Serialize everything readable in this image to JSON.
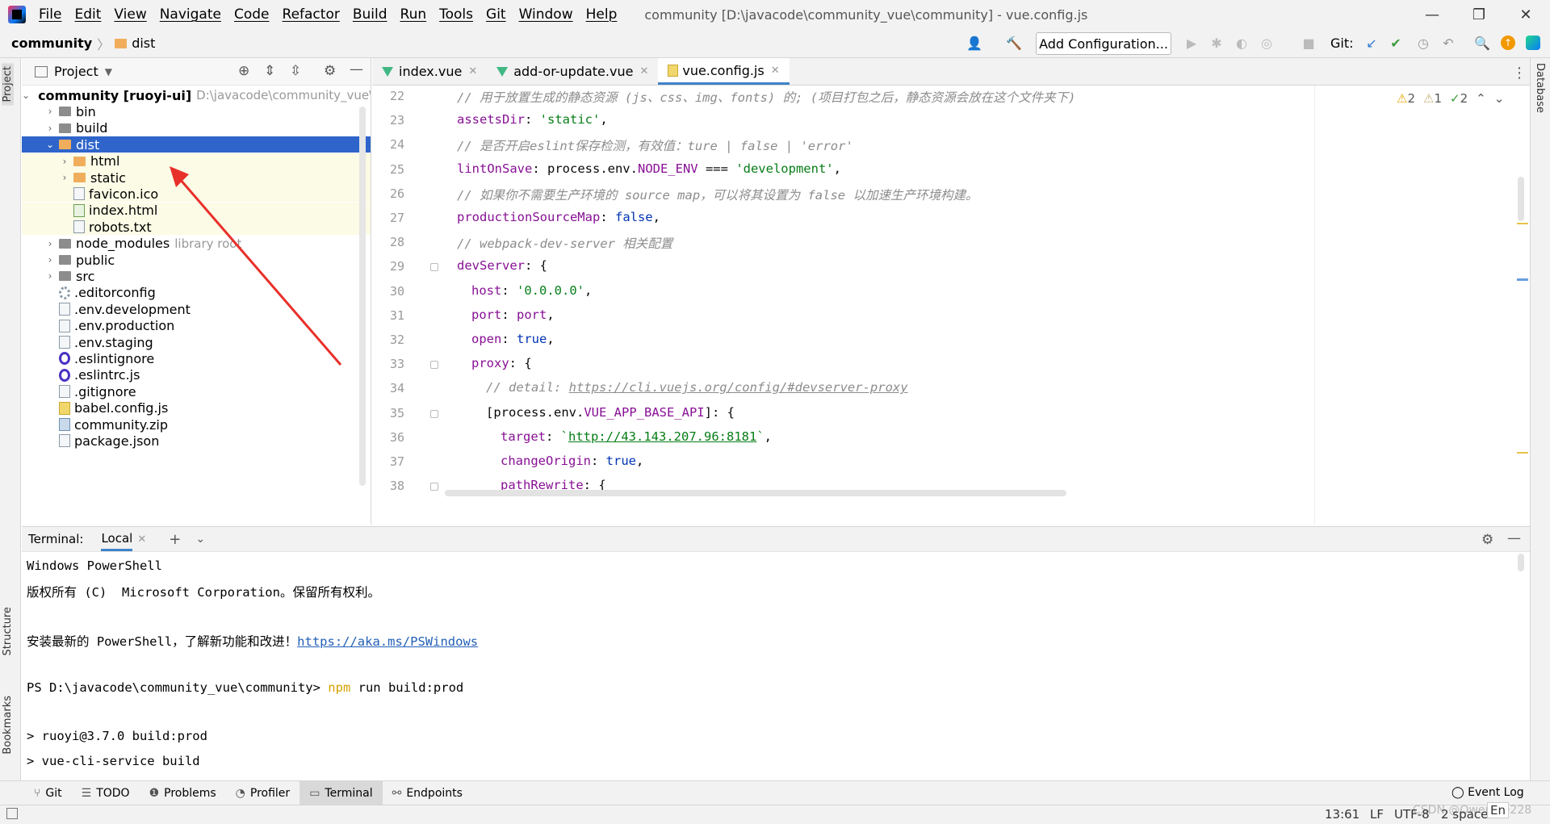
{
  "menu": {
    "items": [
      "File",
      "Edit",
      "View",
      "Navigate",
      "Code",
      "Refactor",
      "Build",
      "Run",
      "Tools",
      "Git",
      "Window",
      "Help"
    ],
    "window_title": "community [D:\\javacode\\community_vue\\community] - vue.config.js"
  },
  "window_controls": {
    "minimize": "—",
    "restore": "❐",
    "close": "✕"
  },
  "navbar": {
    "project": "community",
    "crumb": "dist",
    "add_config": "Add Configuration...",
    "git_label": "Git:"
  },
  "project_panel": {
    "title": "Project",
    "tree": [
      {
        "label": "community [ruoyi-ui]",
        "extra": "D:\\javacode\\community_vue\\",
        "type": "root",
        "depth": 0,
        "expanded": true
      },
      {
        "label": "bin",
        "type": "folder",
        "depth": 1
      },
      {
        "label": "build",
        "type": "folder",
        "depth": 1
      },
      {
        "label": "dist",
        "type": "folder-orange",
        "depth": 1,
        "expanded": true,
        "selected": true
      },
      {
        "label": "html",
        "type": "folder-orange",
        "depth": 2
      },
      {
        "label": "static",
        "type": "folder-orange",
        "depth": 2
      },
      {
        "label": "favicon.ico",
        "type": "file",
        "depth": 2
      },
      {
        "label": "index.html",
        "type": "html",
        "depth": 2
      },
      {
        "label": "robots.txt",
        "type": "file",
        "depth": 2
      },
      {
        "label": "node_modules",
        "extra": "library root",
        "type": "folder",
        "depth": 1
      },
      {
        "label": "public",
        "type": "folder",
        "depth": 1
      },
      {
        "label": "src",
        "type": "folder",
        "depth": 1
      },
      {
        "label": ".editorconfig",
        "type": "gear",
        "depth": 1
      },
      {
        "label": ".env.development",
        "type": "file",
        "depth": 1
      },
      {
        "label": ".env.production",
        "type": "file",
        "depth": 1
      },
      {
        "label": ".env.staging",
        "type": "file",
        "depth": 1
      },
      {
        "label": ".eslintignore",
        "type": "eslint",
        "depth": 1
      },
      {
        "label": ".eslintrc.js",
        "type": "eslint",
        "depth": 1
      },
      {
        "label": ".gitignore",
        "type": "file",
        "depth": 1
      },
      {
        "label": "babel.config.js",
        "type": "js",
        "depth": 1
      },
      {
        "label": "community.zip",
        "type": "zip",
        "depth": 1
      },
      {
        "label": "package.json",
        "type": "file",
        "depth": 1
      }
    ]
  },
  "editor": {
    "tabs": [
      {
        "label": "index.vue",
        "icon": "vue-icon",
        "active": false
      },
      {
        "label": "add-or-update.vue",
        "icon": "vue-icon",
        "active": false
      },
      {
        "label": "vue.config.js",
        "icon": "js-icon",
        "active": true
      }
    ],
    "inspections": {
      "warnings": "2",
      "weak_warnings": "1",
      "typos": "2"
    },
    "line_numbers": [
      "22",
      "23",
      "24",
      "25",
      "26",
      "27",
      "28",
      "29",
      "30",
      "31",
      "32",
      "33",
      "34",
      "35",
      "36",
      "37",
      "38"
    ],
    "lines": [
      {
        "indent": 0,
        "parts": [
          {
            "t": "// 用于放置生成的静态资源 (js、css、img、fonts) 的; (项目打包之后，静态资源会放在这个文件夹下)",
            "c": "c-comment"
          }
        ]
      },
      {
        "indent": 0,
        "parts": [
          {
            "t": "assetsDir",
            "c": "c-prop"
          },
          {
            "t": ": ",
            "c": ""
          },
          {
            "t": "'static'",
            "c": "c-str"
          },
          {
            "t": ",",
            "c": ""
          }
        ]
      },
      {
        "indent": 0,
        "parts": [
          {
            "t": "// 是否开启eslint保存检测，有效值：ture | false | 'error'",
            "c": "c-comment"
          }
        ]
      },
      {
        "indent": 0,
        "parts": [
          {
            "t": "lintOnSave",
            "c": "c-prop"
          },
          {
            "t": ": process.env.",
            "c": ""
          },
          {
            "t": "NODE_ENV",
            "c": "c-prop"
          },
          {
            "t": " === ",
            "c": ""
          },
          {
            "t": "'development'",
            "c": "c-str"
          },
          {
            "t": ",",
            "c": ""
          }
        ]
      },
      {
        "indent": 0,
        "parts": [
          {
            "t": "// 如果你不需要生产环境的 source map，可以将其设置为 false 以加速生产环境构建。",
            "c": "c-comment"
          }
        ]
      },
      {
        "indent": 0,
        "parts": [
          {
            "t": "productionSourceMap",
            "c": "c-prop"
          },
          {
            "t": ": ",
            "c": ""
          },
          {
            "t": "false",
            "c": "c-kw"
          },
          {
            "t": ",",
            "c": ""
          }
        ]
      },
      {
        "indent": 0,
        "parts": [
          {
            "t": "// webpack-dev-server 相关配置",
            "c": "c-comment"
          }
        ]
      },
      {
        "indent": 0,
        "parts": [
          {
            "t": "devServer",
            "c": "c-prop"
          },
          {
            "t": ": {",
            "c": ""
          }
        ]
      },
      {
        "indent": 1,
        "parts": [
          {
            "t": "host",
            "c": "c-prop"
          },
          {
            "t": ": ",
            "c": ""
          },
          {
            "t": "'0.0.0.0'",
            "c": "c-str"
          },
          {
            "t": ",",
            "c": ""
          }
        ]
      },
      {
        "indent": 1,
        "parts": [
          {
            "t": "port",
            "c": "c-prop"
          },
          {
            "t": ": ",
            "c": ""
          },
          {
            "t": "port",
            "c": "c-prop"
          },
          {
            "t": ",",
            "c": ""
          }
        ]
      },
      {
        "indent": 1,
        "parts": [
          {
            "t": "open",
            "c": "c-prop"
          },
          {
            "t": ": ",
            "c": ""
          },
          {
            "t": "true",
            "c": "c-kw"
          },
          {
            "t": ",",
            "c": ""
          }
        ]
      },
      {
        "indent": 1,
        "parts": [
          {
            "t": "proxy",
            "c": "c-prop"
          },
          {
            "t": ": {",
            "c": ""
          }
        ]
      },
      {
        "indent": 2,
        "parts": [
          {
            "t": "// detail: ",
            "c": "c-comment"
          },
          {
            "t": "https://cli.vuejs.org/config/#devserver-proxy",
            "c": "c-link"
          }
        ]
      },
      {
        "indent": 2,
        "parts": [
          {
            "t": "[process.env.",
            "c": ""
          },
          {
            "t": "VUE_APP_BASE_API",
            "c": "c-prop"
          },
          {
            "t": "]: {",
            "c": ""
          }
        ]
      },
      {
        "indent": 3,
        "parts": [
          {
            "t": "target",
            "c": "c-prop"
          },
          {
            "t": ": ",
            "c": ""
          },
          {
            "t": "`",
            "c": "c-str"
          },
          {
            "t": "http://43.143.207.96:8181",
            "c": "c-url"
          },
          {
            "t": "`",
            "c": "c-str"
          },
          {
            "t": ",",
            "c": ""
          }
        ]
      },
      {
        "indent": 3,
        "parts": [
          {
            "t": "changeOrigin",
            "c": "c-prop"
          },
          {
            "t": ": ",
            "c": ""
          },
          {
            "t": "true",
            "c": "c-kw"
          },
          {
            "t": ",",
            "c": ""
          }
        ]
      },
      {
        "indent": 3,
        "parts": [
          {
            "t": "pathRewrite",
            "c": "c-prop"
          },
          {
            "t": ": {",
            "c": ""
          }
        ]
      }
    ]
  },
  "terminal": {
    "label": "Terminal:",
    "tab": "Local",
    "lines": [
      {
        "t": "Windows PowerShell"
      },
      {
        "t": "版权所有 (C)  Microsoft Corporation。保留所有权利。"
      },
      {
        "t": ""
      },
      {
        "t": "安装最新的 PowerShell，了解新功能和改进！",
        "link": "https://aka.ms/PSWindows"
      },
      {
        "t": ""
      },
      {
        "t": "PS D:\\javacode\\community_vue\\community> ",
        "npm": "npm",
        "rest": " run build:prod"
      },
      {
        "t": ""
      },
      {
        "t": "> ruoyi@3.7.0 build:prod"
      },
      {
        "t": "> vue-cli-service build"
      }
    ]
  },
  "bottom_tabs": [
    {
      "label": "Git",
      "icon": "git-icon"
    },
    {
      "label": "TODO",
      "icon": "list-icon"
    },
    {
      "label": "Problems",
      "icon": "problems-icon"
    },
    {
      "label": "Profiler",
      "icon": "profiler-icon"
    },
    {
      "label": "Terminal",
      "icon": "terminal-icon",
      "active": true
    },
    {
      "label": "Endpoints",
      "icon": "endpoints-icon"
    }
  ],
  "event_log": "Event Log",
  "side_tabs": {
    "project": "Project",
    "structure": "Structure",
    "bookmarks": "Bookmarks",
    "database": "Database"
  },
  "status": {
    "position": "13:61",
    "line_sep": "LF",
    "encoding": "UTF-8",
    "indent": "2 spaces",
    "watermark": "CSDN @OwenXie228",
    "ime": "En"
  }
}
